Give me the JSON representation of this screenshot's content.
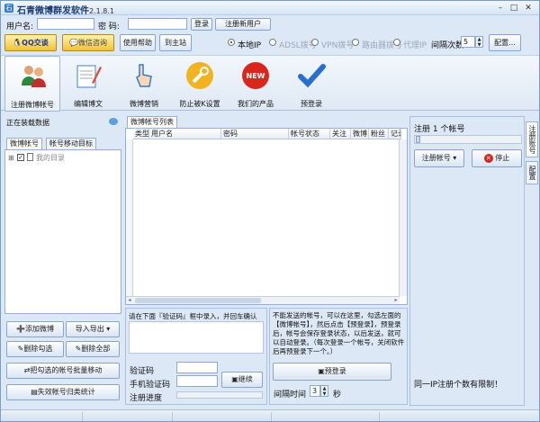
{
  "window": {
    "title": "石青微博群发软件",
    "version": "2.1.8.1",
    "min": "–",
    "max": "□",
    "close": "✕"
  },
  "login": {
    "user_label": "用户名:",
    "user_value": "",
    "pass_label": "密  码:",
    "pass_value": "",
    "login_btn": "登录",
    "register_btn": "注册新用户"
  },
  "toolbar2": {
    "qq_btn": "QQ交谈",
    "wx_btn": "微信咨询",
    "help_btn": "使用帮助",
    "site_btn": "到主站",
    "ip_options": [
      {
        "label": "本地IP",
        "selected": true
      },
      {
        "label": "ADSL拨号",
        "selected": false
      },
      {
        "label": "VPN拨号",
        "selected": false
      },
      {
        "label": "路由器拨号",
        "selected": false
      },
      {
        "label": "代理IP",
        "selected": false
      }
    ],
    "interval_label": "间隔次数",
    "interval_value": "5",
    "config_btn": "配置..."
  },
  "tools": [
    {
      "label": "注册微博帐号",
      "icon": "users-icon"
    },
    {
      "label": "编辑博文",
      "icon": "notepad-icon"
    },
    {
      "label": "微博营销",
      "icon": "pointer-icon"
    },
    {
      "label": "防止被K设置",
      "icon": "wrench-icon"
    },
    {
      "label": "我们的产品",
      "icon": "new-badge-icon"
    },
    {
      "label": "预登录",
      "icon": "checkmark-icon"
    }
  ],
  "left": {
    "loading_text": "正在装载数据",
    "tabs": [
      "微博帐号",
      "帐号移动目标"
    ],
    "tree_root": "我的目录",
    "buttons": {
      "add": "添加微博",
      "import": "导入导出",
      "del_checked": "删除勾选",
      "del_all": "删除全部",
      "move": "把勾选的帐号批量移动",
      "fail_stats": "失效帐号归类统计"
    }
  },
  "center": {
    "tab": "微博帐号列表",
    "columns": [
      "类型",
      "用户名",
      "密码",
      "帐号状态",
      "关注",
      "微博",
      "粉丝",
      "记录"
    ],
    "captcha_hint": "请在下面『验证码』框中录入，并回车确认",
    "captcha_label": "验证码",
    "phone_label": "手机验证码",
    "progress_label": "注册进度",
    "continue_btn": "继续",
    "note": "不能发送的帐号，可以在这里，勾选左面的【微博帐号】，然后点击【预登录】，预登录后，帐号会保存登录状态，以后发送，就可以自动登录。（每次登录一个帐号，关闭软件后再预登录下一个。）",
    "prelogin_btn": "预登录",
    "interval_label": "间隔时间",
    "interval_value": "3",
    "interval_unit": "秒"
  },
  "right": {
    "count_label": "注册 1 个帐号",
    "register_btn": "注册帐号",
    "stop_btn": "停止",
    "footer": "同一IP注册个数有限制！",
    "vtabs": [
      "注册账号",
      "配置"
    ]
  }
}
